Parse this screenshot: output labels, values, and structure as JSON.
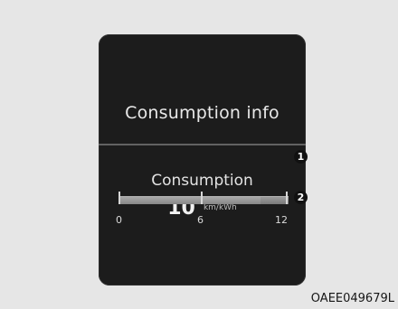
{
  "screen": {
    "title": "Consumption info",
    "consumption_label": "Consumption",
    "consumption_value": "10",
    "consumption_unit": "km/kWh"
  },
  "gauge": {
    "scale_min": "0",
    "scale_mid": "6",
    "scale_max": "12",
    "current_value": 10
  },
  "callouts": {
    "one": "1",
    "two": "2"
  },
  "figure_code": "OAEE049679L"
}
